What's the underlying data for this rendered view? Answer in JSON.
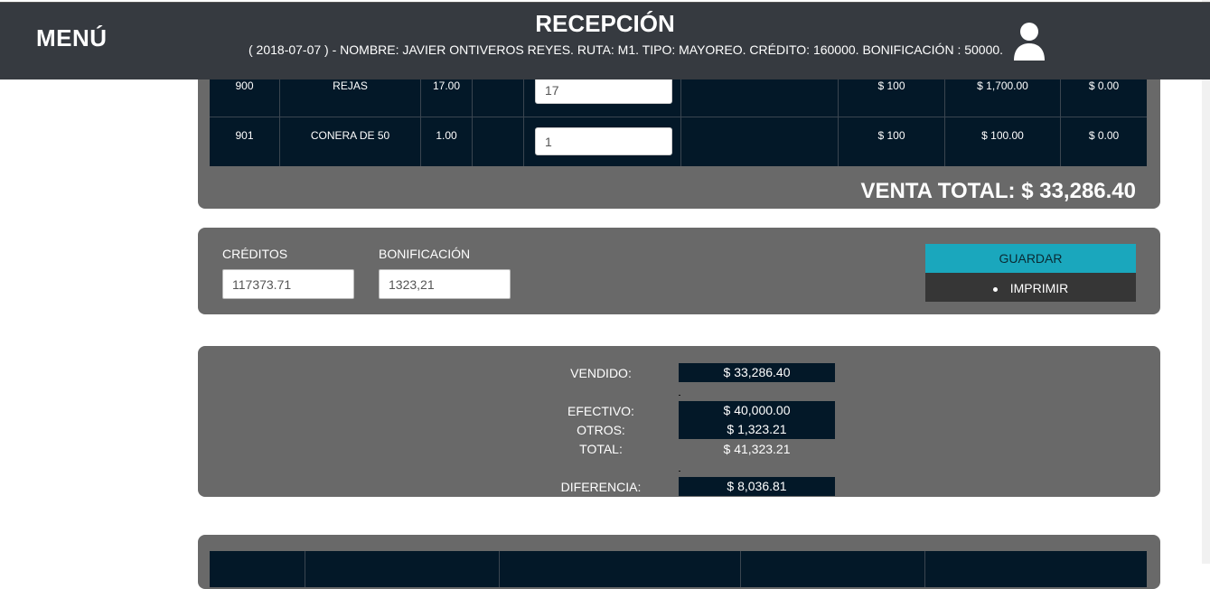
{
  "header": {
    "menu": "MENÚ",
    "title": "RECEPCIÓN",
    "subtitle": "( 2018-07-07 ) - NOMBRE: JAVIER ONTIVEROS REYES. RUTA: M1. TIPO: MAYOREO. CRÉDITO: 160000. BONIFICACIÓN : 50000."
  },
  "products": [
    {
      "code": "900",
      "name": "REJAS",
      "qty": "17.00",
      "input": "17",
      "price": "$ 100",
      "total": "$ 1,700.00",
      "extra": "$ 0.00"
    },
    {
      "code": "901",
      "name": "CONERA DE 50",
      "qty": "1.00",
      "input": "1",
      "price": "$ 100",
      "total": "$ 100.00",
      "extra": "$ 0.00"
    }
  ],
  "venta_total": "VENTA TOTAL: $ 33,286.40",
  "creditos": {
    "label": "CRÉDITOS",
    "value": "117373.71"
  },
  "bonificacion": {
    "label": "BONIFICACIÓN",
    "value": "1323,21"
  },
  "actions": {
    "save": "GUARDAR",
    "print": "IMPRIMIR"
  },
  "summary": {
    "vendido_label": "VENDIDO:",
    "vendido": "$ 33,286.40",
    "efectivo_label": "EFECTIVO:",
    "efectivo": "$ 40,000.00",
    "otros_label": "OTROS:",
    "otros": "$ 1,323.21",
    "total_label": "TOTAL:",
    "total": "$ 41,323.21",
    "diferencia_label": "DIFERENCIA:",
    "diferencia": "$ 8,036.81"
  },
  "colors": {
    "header_bg": "#363a40",
    "panel_bg": "#696969",
    "table_bg": "#031828",
    "save_btn": "#1aa7bd"
  }
}
